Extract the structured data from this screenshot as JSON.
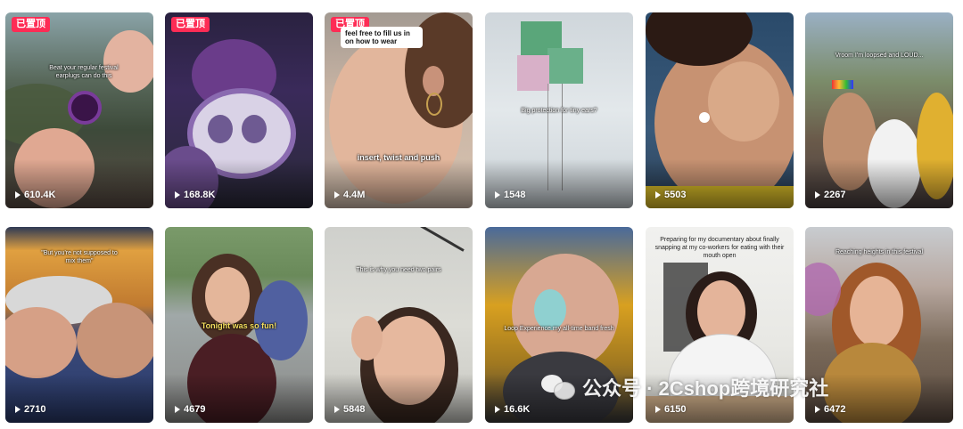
{
  "tiles": [
    {
      "pinned": true,
      "caption": "Beat your regular festival earplugs can do this",
      "views": "610.4K"
    },
    {
      "pinned": true,
      "caption": "",
      "views": "168.8K"
    },
    {
      "pinned": true,
      "caption": "feel free to fill us in on how to wear",
      "caption2": "insert, twist and push",
      "views": "4.4M"
    },
    {
      "pinned": false,
      "caption": "Big protection for tiny ears?",
      "views": "1548"
    },
    {
      "pinned": false,
      "caption": "",
      "views": "5503"
    },
    {
      "pinned": false,
      "caption": "Vroom I'm loopsed and LOUD...",
      "views": "2267"
    },
    {
      "pinned": false,
      "caption": "\"But you're not supposed to mix them\"",
      "views": "2710"
    },
    {
      "pinned": false,
      "caption": "Tonight was so fun!",
      "views": "4679"
    },
    {
      "pinned": false,
      "caption": "This is why you need two pairs",
      "views": "5848"
    },
    {
      "pinned": false,
      "caption": "Loop Experience my all-time band fresh",
      "views": "16.6K"
    },
    {
      "pinned": false,
      "caption": "Preparing for my documentary about finally snapping at my co-workers for eating with their mouth open",
      "views": "6150"
    },
    {
      "pinned": false,
      "caption": "Reaching heights in this festival",
      "views": "6472"
    }
  ],
  "pin_label": "已置顶",
  "watermark": {
    "text": "公众号 · 2Cshop跨境研究社",
    "icon": "wechat-icon"
  },
  "colors": {
    "pin": "#fe2c55",
    "view_text": "#ffffff"
  }
}
